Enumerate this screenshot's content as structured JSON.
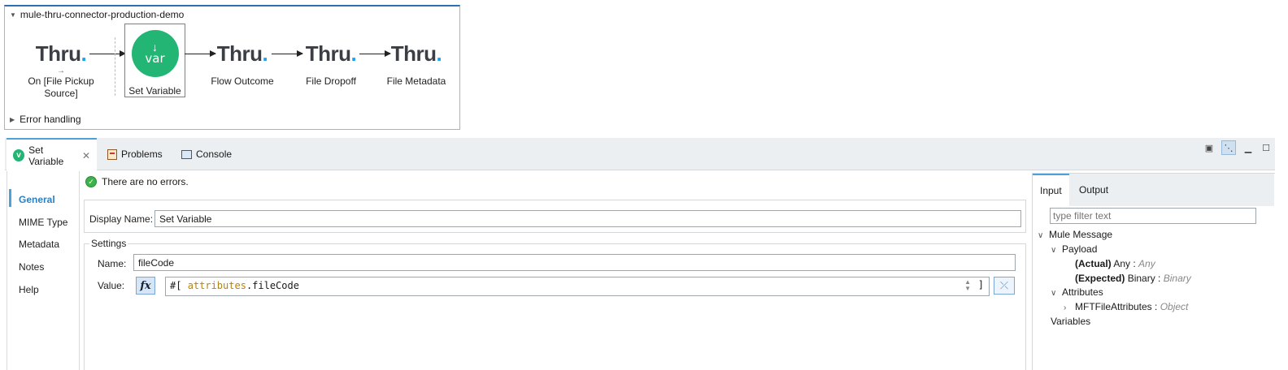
{
  "flow": {
    "name": "mule-thru-connector-production-demo",
    "components": [
      {
        "icon": "thru-logo",
        "logo_text": "Thru",
        "logo_dot": ".",
        "label": "On [File Pickup Source]",
        "source_marker": "→"
      },
      {
        "icon": "var-icon",
        "icon_text": "var",
        "label": "Set Variable"
      },
      {
        "icon": "thru-logo",
        "logo_text": "Thru",
        "logo_dot": ".",
        "label": "Flow Outcome"
      },
      {
        "icon": "thru-logo",
        "logo_text": "Thru",
        "logo_dot": ".",
        "label": "File Dropoff"
      },
      {
        "icon": "thru-logo",
        "logo_text": "Thru",
        "logo_dot": ".",
        "label": "File Metadata"
      }
    ],
    "error_handling": "Error handling"
  },
  "tabs": [
    {
      "label": "Set Variable",
      "icon": "v-icon",
      "active": true
    },
    {
      "label": "Problems",
      "icon": "problems-icon"
    },
    {
      "label": "Console",
      "icon": "console-icon"
    }
  ],
  "nav": [
    "General",
    "MIME Type",
    "Metadata",
    "Notes",
    "Help"
  ],
  "status": "There are no errors.",
  "form": {
    "display_name_label": "Display Name:",
    "display_name_value": "Set Variable",
    "settings_legend": "Settings",
    "name_label": "Name:",
    "name_value": "fileCode",
    "value_label": "Value:",
    "fx_label": "fx",
    "expr_open": "#[",
    "expr_keyword": "attributes",
    "expr_rest": ".fileCode",
    "expr_close": "]"
  },
  "metadata": {
    "tabs": [
      "Input",
      "Output"
    ],
    "filter_placeholder": "type filter text",
    "tree": {
      "mule_message": "Mule Message",
      "payload": "Payload",
      "actual_label": "(Actual)",
      "actual_type": "Any :",
      "actual_type_ital": "Any",
      "expected_label": "(Expected)",
      "expected_type": "Binary :",
      "expected_type_ital": "Binary",
      "attributes": "Attributes",
      "mft_name": "MFTFileAttributes :",
      "mft_type": "Object",
      "variables": "Variables"
    }
  },
  "colors": {
    "accent": "#4f9fd8",
    "mule_green": "#22b573",
    "thru_blue": "#1aa3e8"
  }
}
